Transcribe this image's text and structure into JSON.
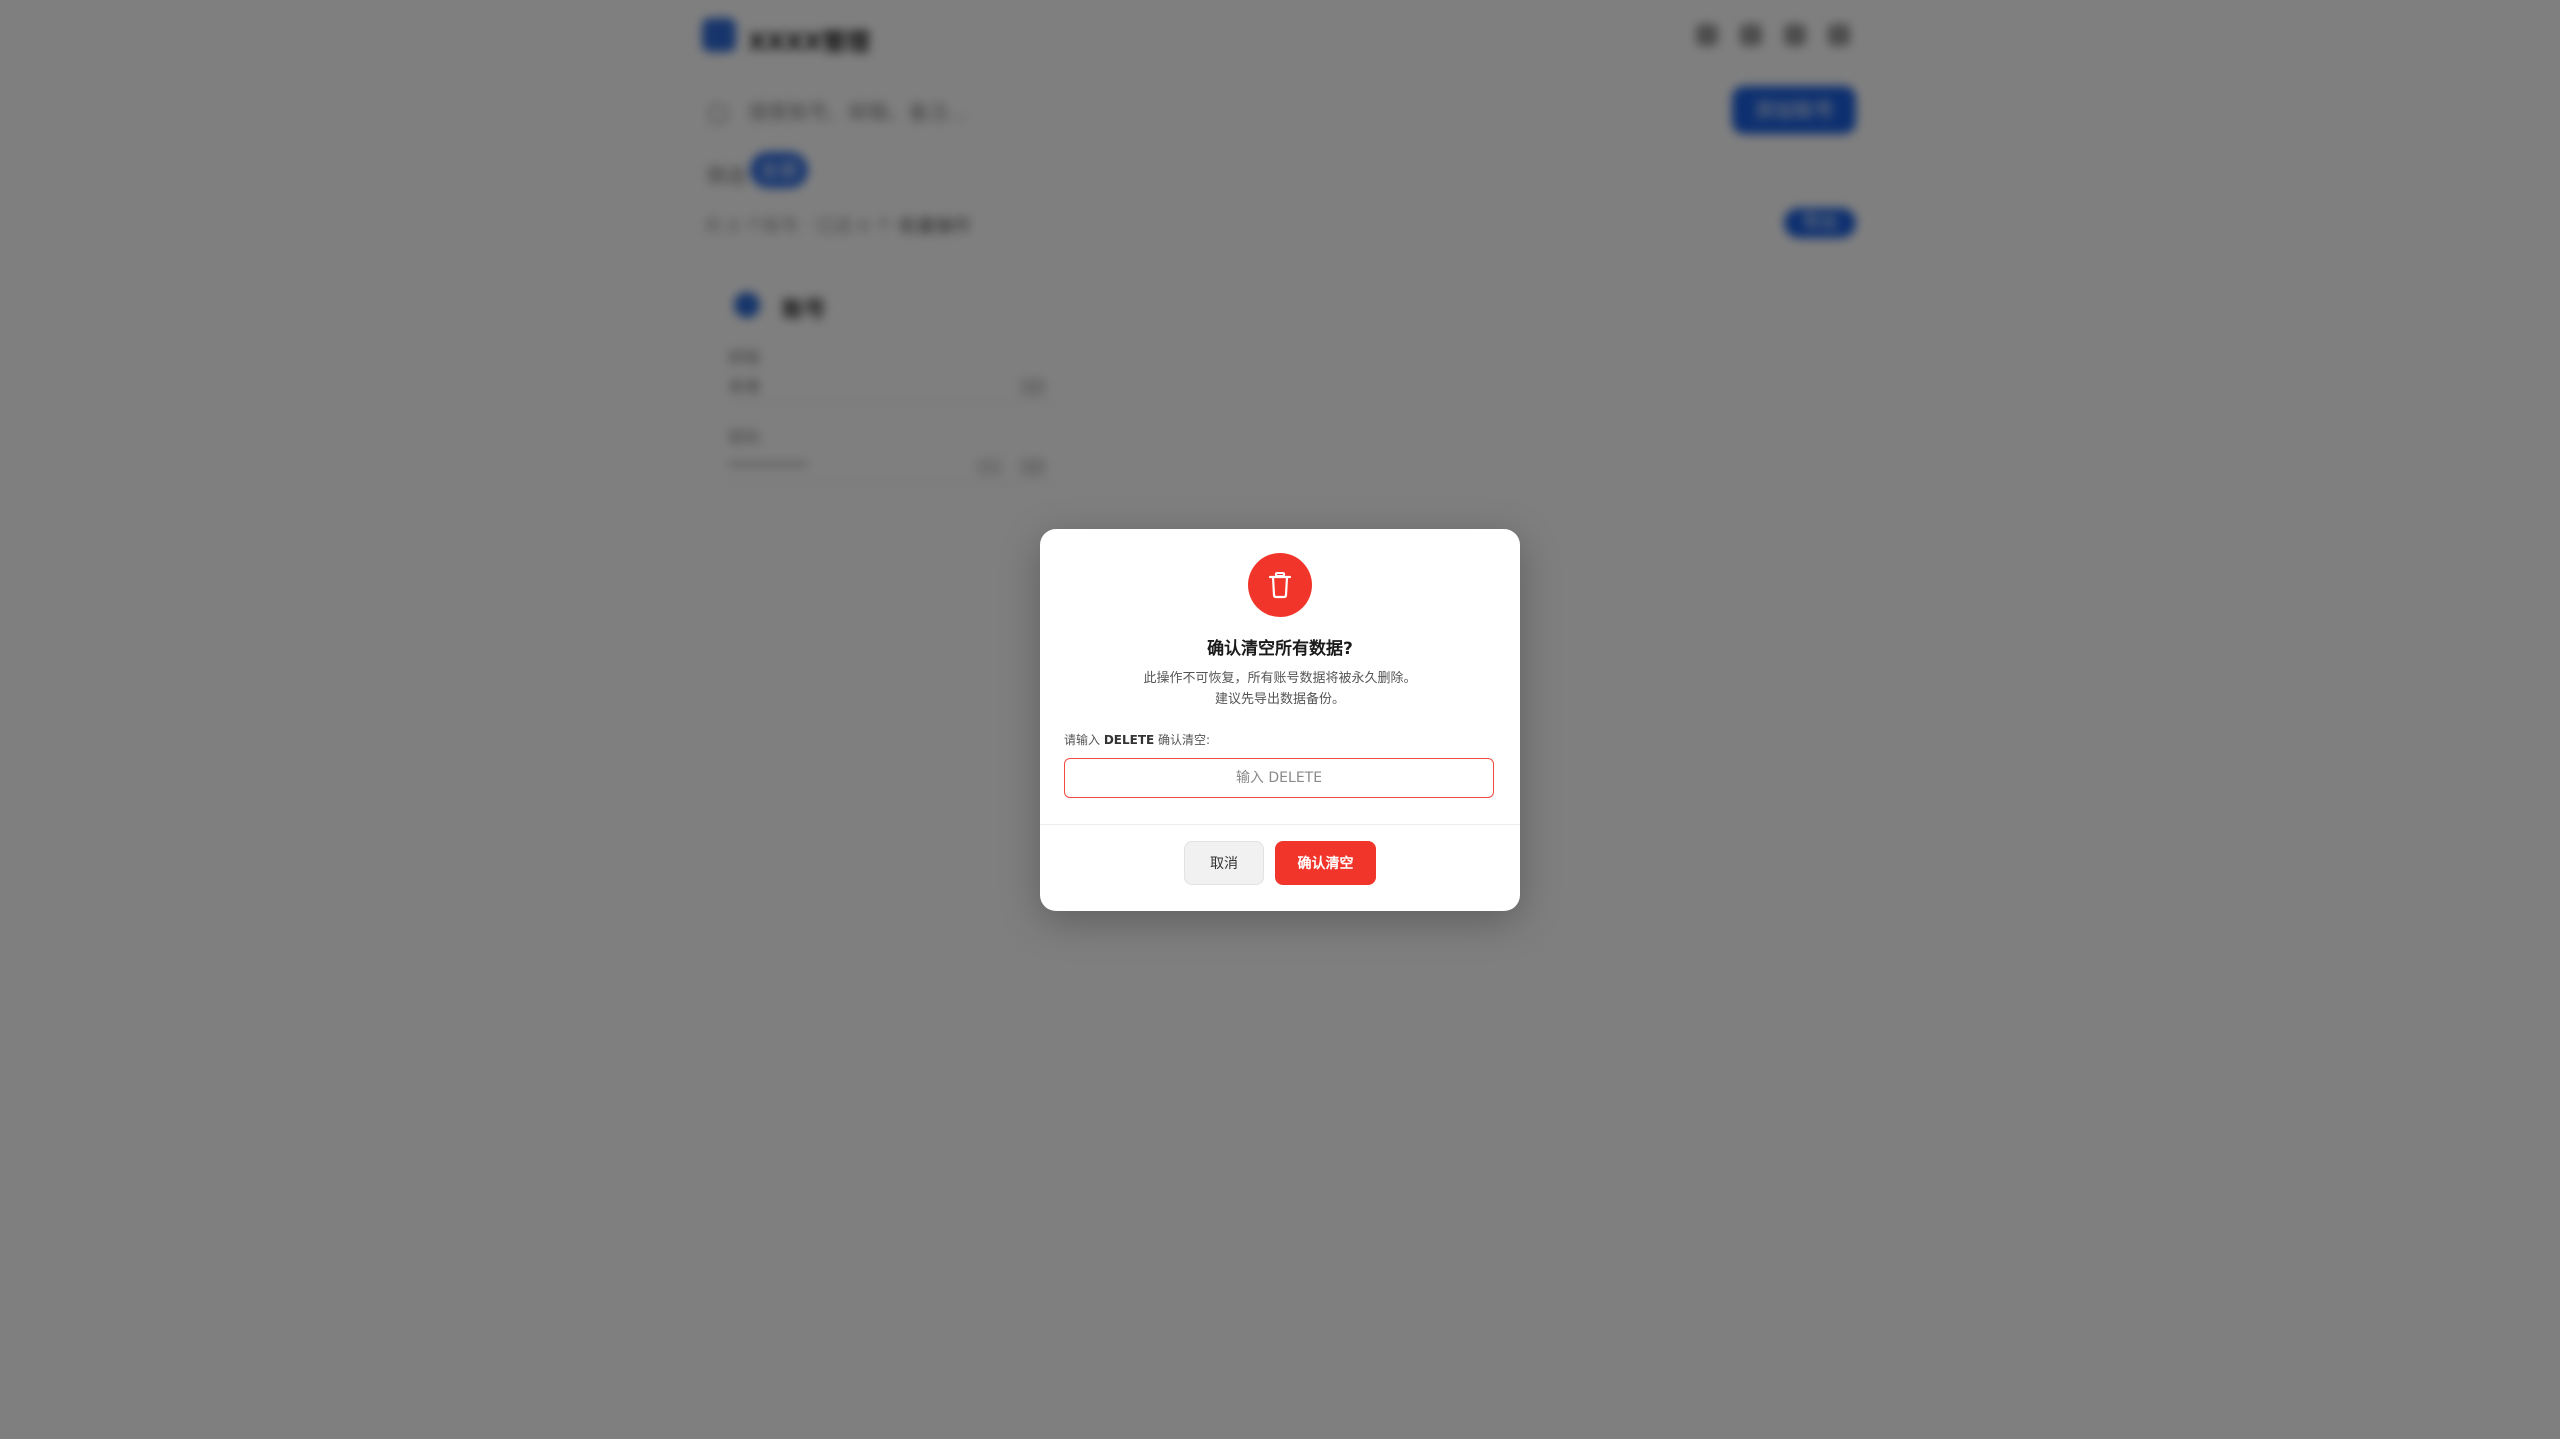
{
  "background": {
    "app_title": "XXXX管理",
    "search_placeholder": "搜索账号、邮箱、备注…",
    "primary_button": "添加账号",
    "filter_label": "筛选",
    "filter_chip": "全部",
    "breadcrumb": "共 0 个账号 · 已选 0 个",
    "breadcrumb_strong": "批量操作",
    "small_button": "导出",
    "card_name": "账号",
    "field1_label": "邮箱",
    "field1_value": "未填",
    "field2_label": "密码",
    "field2_value": "**********"
  },
  "dialog": {
    "title": "确认清空所有数据?",
    "desc_line1": "此操作不可恢复，所有账号数据将被永久删除。",
    "desc_line2": "建议先导出数据备份。",
    "prompt_prefix": "请输入 ",
    "prompt_keyword": "DELETE",
    "prompt_suffix": " 确认清空:",
    "input_placeholder": "输入 DELETE",
    "input_value": "",
    "cancel_label": "取消",
    "confirm_label": "确认清空"
  },
  "colors": {
    "danger": "#f1352a",
    "primary": "#1a5fe0",
    "overlay": "rgba(0,0,0,0.5)"
  },
  "icons": {
    "dialog_icon": "trash-icon"
  }
}
